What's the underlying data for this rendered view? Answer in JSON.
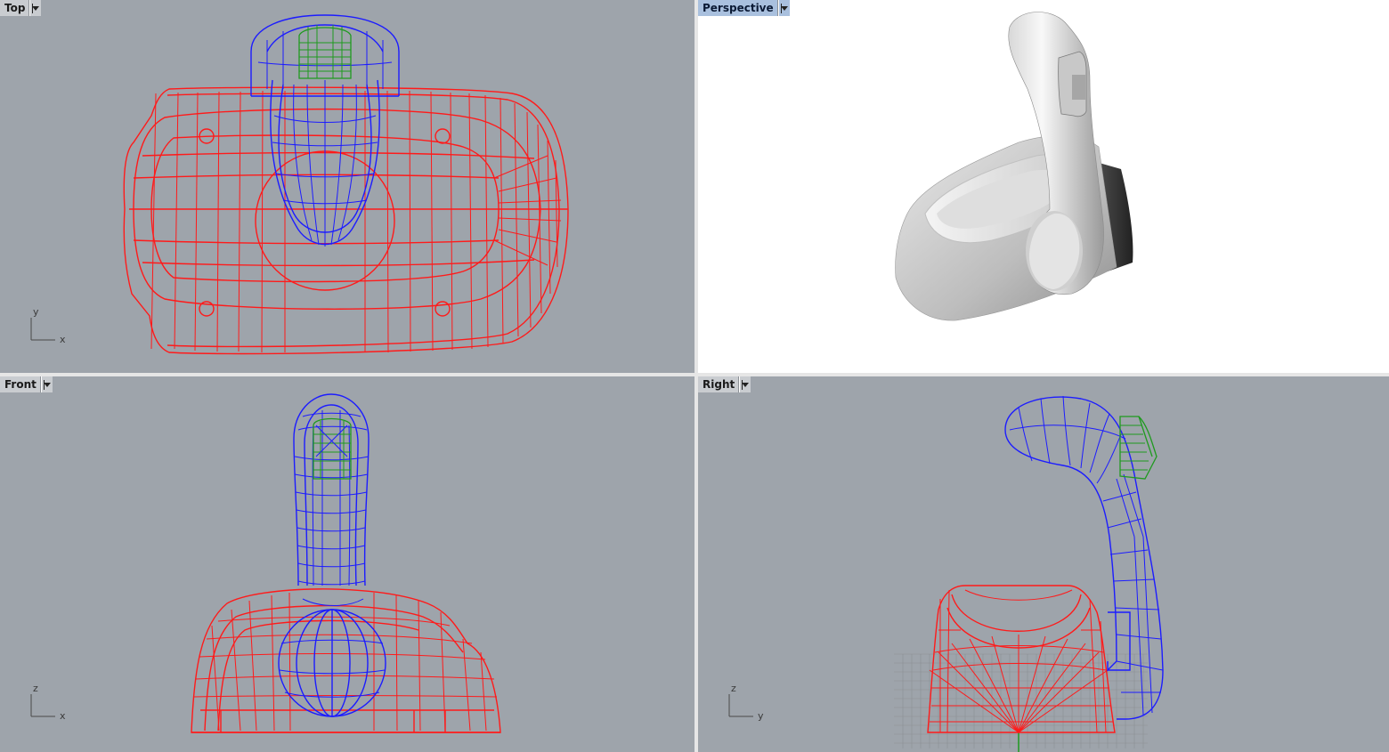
{
  "viewports": {
    "top": {
      "title": "Top",
      "axis_h": "x",
      "axis_v": "y"
    },
    "persp": {
      "title": "Perspective"
    },
    "front": {
      "title": "Front",
      "axis_h": "x",
      "axis_v": "z"
    },
    "right": {
      "title": "Right",
      "axis_h": "y",
      "axis_v": "z"
    }
  },
  "colors": {
    "viewport_bg": "#9ea4ab",
    "perspective_bg": "#ffffff",
    "wire_base": "#ff1a1a",
    "wire_lever": "#1c1cff",
    "wire_button": "#1f9a1f",
    "active_title": "#a9c0de"
  }
}
